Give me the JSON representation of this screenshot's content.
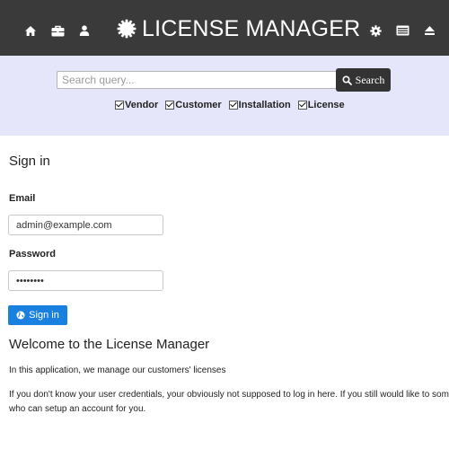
{
  "header": {
    "brand_title": "LICENSE MANAGER",
    "left_icons": [
      "home-icon",
      "briefcase-icon",
      "user-icon"
    ],
    "right_icons": [
      "gear-icon",
      "list-window-icon",
      "eject-icon"
    ],
    "bar_color": "#3a3a3a"
  },
  "search": {
    "placeholder": "Search query...",
    "value": "",
    "button_label": "Search",
    "band_color": "#e5e6fa",
    "filters": [
      {
        "label": "Vendor",
        "checked": true
      },
      {
        "label": "Customer",
        "checked": true
      },
      {
        "label": "Installation",
        "checked": true
      },
      {
        "label": "License",
        "checked": true
      }
    ]
  },
  "signin": {
    "title": "Sign in",
    "email_label": "Email",
    "email_value": "admin@example.com",
    "password_label": "Password",
    "password_value": "••••••••",
    "button_label": "Sign in",
    "button_color": "#1a80e0"
  },
  "welcome": {
    "title": "Welcome to the License Manager",
    "paragraph1": "In this application, we manage our customers' licenses",
    "paragraph2": "If you don't know your user credentials, your obviously not supposed to log in here. If you still would like to someone who can setup an account for you."
  }
}
